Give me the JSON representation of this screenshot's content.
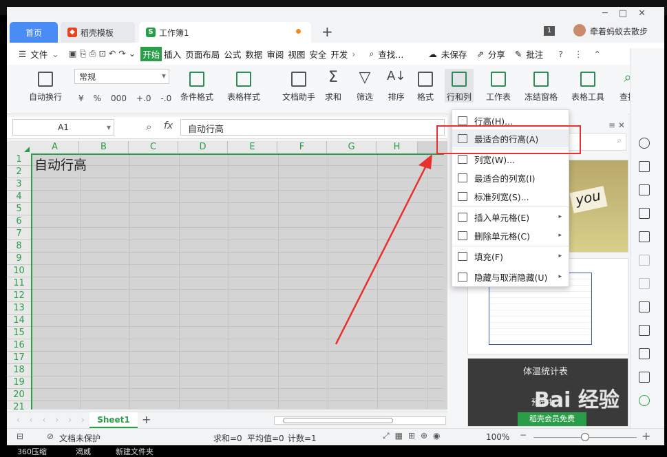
{
  "tabs": {
    "home": "首页",
    "daoke": "稻壳模板",
    "workbook": "工作簿1",
    "user": "牵着蚂蚁去散步",
    "badge": "1"
  },
  "menu": {
    "file": "文件",
    "items": [
      "开始",
      "插入",
      "页面布局",
      "公式",
      "数据",
      "审阅",
      "视图",
      "安全",
      "开发"
    ],
    "search": "查找...",
    "unsaved": "未保存",
    "share": "分享",
    "comment": "批注"
  },
  "ribbon": {
    "wrap": "自动换行",
    "number_format": "常规",
    "cond_format": "条件格式",
    "table_style": "表格样式",
    "doc_helper": "文档助手",
    "sum": "求和",
    "filter": "筛选",
    "sort": "排序",
    "format": "格式",
    "rowcol": "行和列",
    "worksheet": "工作表",
    "freeze": "冻结窗格",
    "table_tools": "表格工具",
    "find": "查找",
    "currency": "¥",
    "percent": "%",
    "thousand": "000",
    "dec_inc": "+.0",
    "dec_dec": "-.0"
  },
  "formula": {
    "cell_ref": "A1",
    "fx": "fx",
    "value": "自动行高"
  },
  "grid": {
    "columns": [
      "A",
      "B",
      "C",
      "D",
      "E",
      "F",
      "G",
      "H"
    ],
    "rows": [
      "1",
      "2",
      "3",
      "4",
      "5",
      "6",
      "7",
      "8",
      "9",
      "10",
      "11",
      "12",
      "13",
      "14",
      "15",
      "16",
      "17",
      "18",
      "19",
      "20",
      "21"
    ],
    "a1": "自动行高"
  },
  "context_menu": [
    {
      "label": "行高(H)...",
      "submenu": false
    },
    {
      "label": "最适合的行高(A)",
      "submenu": false
    },
    {
      "label": "列宽(W)...",
      "submenu": false
    },
    {
      "label": "最适合的列宽(I)",
      "submenu": false
    },
    {
      "label": "标准列宽(S)...",
      "submenu": false
    },
    {
      "label": "插入单元格(E)",
      "submenu": true
    },
    {
      "label": "删除单元格(C)",
      "submenu": true
    },
    {
      "label": "填充(F)",
      "submenu": true
    },
    {
      "label": "隐藏与取消隐藏(U)",
      "submenu": true
    }
  ],
  "sheet": {
    "name": "Sheet1"
  },
  "status": {
    "protect": "文档未保护",
    "sum": "求和=0",
    "avg": "平均值=0",
    "count": "计数=1",
    "zoom": "100%"
  },
  "panel": {
    "tmpl2_title": "体温统计表",
    "preview": "预览中",
    "member": "稻壳会员免费",
    "you": "you"
  },
  "watermark": "Bai 经验",
  "desktop": {
    "icons": [
      "360压缩",
      "渴威",
      "新建文件夹"
    ]
  },
  "colors": {
    "accent": "#4a8cf5",
    "green": "#2a9d49",
    "highlight": "#e8302e"
  }
}
